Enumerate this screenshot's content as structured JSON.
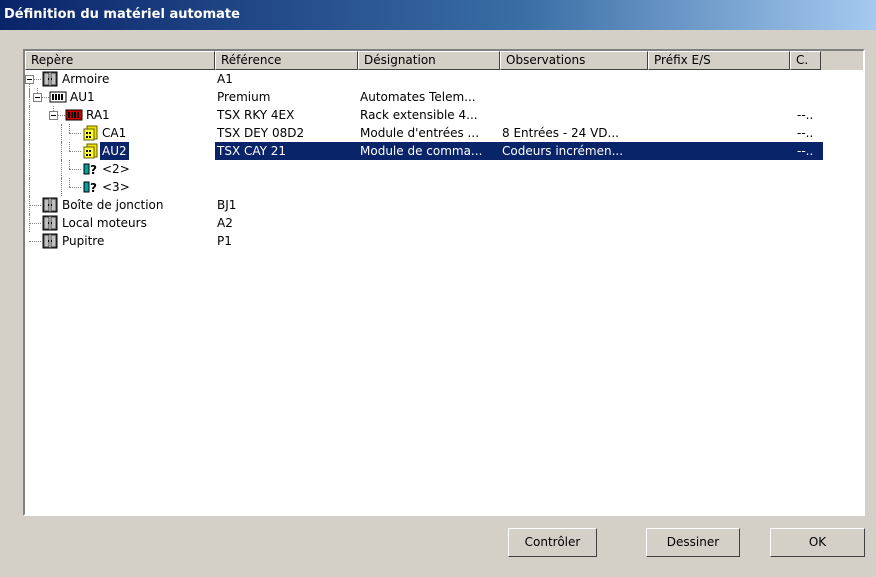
{
  "window": {
    "title": "Définition du matériel automate"
  },
  "columns": [
    "Repère",
    "Référence",
    "Désignation",
    "Observations",
    "Préfix E/S",
    "C."
  ],
  "rows": [
    {
      "label": "Armoire",
      "reference": "A1",
      "designation": "",
      "observations": "",
      "prefix": "",
      "c": "",
      "icon": "cabinet-icon"
    },
    {
      "label": "AU1",
      "reference": "Premium",
      "designation": "Automates Telem...",
      "observations": "",
      "prefix": "",
      "c": "",
      "icon": "plc-icon"
    },
    {
      "label": "RA1",
      "reference": "TSX RKY 4EX",
      "designation": "Rack extensible 4...",
      "observations": "",
      "prefix": "",
      "c": "--..",
      "icon": "rack-icon"
    },
    {
      "label": "CA1",
      "reference": "TSX DEY 08D2",
      "designation": "Module d'entrées ...",
      "observations": "8 Entrées - 24 VD...",
      "prefix": "",
      "c": "--..",
      "icon": "module-icon"
    },
    {
      "label": "AU2",
      "reference": "TSX CAY 21",
      "designation": "Module de comma...",
      "observations": "Codeurs incrémen...",
      "prefix": "",
      "c": "--..",
      "icon": "module-icon",
      "selected": true
    },
    {
      "label": "<2>",
      "reference": "",
      "designation": "",
      "observations": "",
      "prefix": "",
      "c": "",
      "icon": "unknown-slot-icon"
    },
    {
      "label": "<3>",
      "reference": "",
      "designation": "",
      "observations": "",
      "prefix": "",
      "c": "",
      "icon": "unknown-slot-icon"
    },
    {
      "label": "Boîte de jonction",
      "reference": "BJ1",
      "designation": "",
      "observations": "",
      "prefix": "",
      "c": "",
      "icon": "cabinet-icon"
    },
    {
      "label": "Local moteurs",
      "reference": "A2",
      "designation": "",
      "observations": "",
      "prefix": "",
      "c": "",
      "icon": "cabinet-icon"
    },
    {
      "label": "Pupitre",
      "reference": "P1",
      "designation": "",
      "observations": "",
      "prefix": "",
      "c": "",
      "icon": "cabinet-icon"
    }
  ],
  "buttons": {
    "check": "Contrôler",
    "draw": "Dessiner",
    "ok": "OK"
  },
  "colors": {
    "title_start": "#0a246a",
    "title_end": "#a6caf0",
    "selection": "#0a246a"
  }
}
